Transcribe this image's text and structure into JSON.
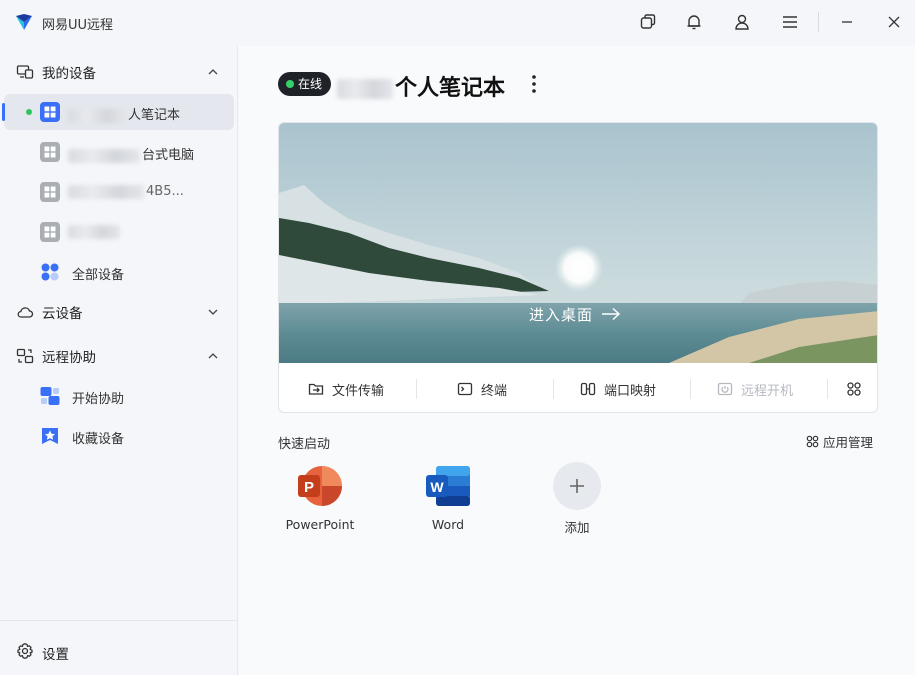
{
  "window": {
    "title": "网易UU远程",
    "icons": [
      "app-logo",
      "window-restore-icon",
      "bell-icon",
      "user-icon",
      "menu-icon",
      "minimize-icon",
      "close-icon"
    ]
  },
  "sidebar": {
    "my_devices": {
      "label": "我的设备",
      "items": [
        {
          "label_suffix": "人笔记本",
          "active": true,
          "online": true,
          "icon": "windows-icon"
        },
        {
          "label_suffix": "台式电脑",
          "active": false,
          "icon": "windows-icon"
        },
        {
          "label_suffix": "4B5...",
          "active": false,
          "icon": "windows-icon"
        },
        {
          "label_suffix": "",
          "active": false,
          "icon": "windows-icon"
        }
      ],
      "all_devices": "全部设备"
    },
    "cloud_devices": {
      "label": "云设备"
    },
    "remote_assist": {
      "label": "远程协助",
      "start": "开始协助",
      "favorites": "收藏设备"
    },
    "settings": "设置"
  },
  "main": {
    "status": "在线",
    "device_title_suffix": "个人笔记本",
    "enter_desktop": "进入桌面",
    "actions": {
      "file_transfer": "文件传输",
      "terminal": "终端",
      "port_mapping": "端口映射",
      "remote_boot": "远程开机"
    },
    "quick_launch": {
      "title": "快速启动",
      "manage": "应用管理",
      "apps": [
        {
          "label": "PowerPoint",
          "icon": "powerpoint-icon"
        },
        {
          "label": "Word",
          "icon": "word-icon"
        },
        {
          "label": "添加",
          "icon": "plus-icon"
        }
      ]
    }
  },
  "colors": {
    "accent": "#3a6ff7",
    "online": "#2fc35b",
    "pill_bg": "#1f2328"
  }
}
